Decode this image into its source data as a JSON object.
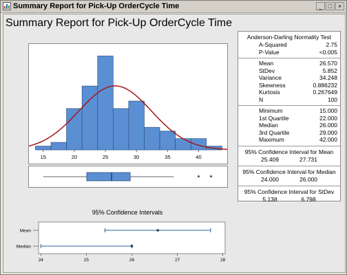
{
  "window": {
    "title": "Summary Report for Pick-Up OrderCycle Time",
    "buttons": {
      "minimize": "_",
      "maximize": "□",
      "close": "×"
    }
  },
  "report_title": "Summary Report for Pick-Up OrderCycle Time",
  "stats": {
    "normality": {
      "title": "Anderson-Darling Normality Test",
      "rows": [
        {
          "label": "A-Squared",
          "value": "2.75"
        },
        {
          "label": "P-Value",
          "value": "<0.005"
        }
      ]
    },
    "moments": [
      {
        "label": "Mean",
        "value": "26.570"
      },
      {
        "label": "StDev",
        "value": "5.852"
      },
      {
        "label": "Variance",
        "value": "34.248"
      },
      {
        "label": "Skewness",
        "value": "0.886232"
      },
      {
        "label": "Kurtosis",
        "value": "0.267649"
      },
      {
        "label": "N",
        "value": "100"
      }
    ],
    "quartiles": [
      {
        "label": "Minimum",
        "value": "15.000"
      },
      {
        "label": "1st Quartile",
        "value": "22.000"
      },
      {
        "label": "Median",
        "value": "26.000"
      },
      {
        "label": "3rd Quartile",
        "value": "29.000"
      },
      {
        "label": "Maximum",
        "value": "42.000"
      }
    ],
    "ci_mean": {
      "title": "95% Confidence Interval for Mean",
      "low": "25.409",
      "high": "27.731"
    },
    "ci_median": {
      "title": "95% Confidence Interval for Median",
      "low": "24.000",
      "high": "26.000"
    },
    "ci_stdev": {
      "title": "95% Confidence Interval for StDev",
      "low": "5.138",
      "high": "6.798"
    }
  },
  "histogram": {
    "bins": [
      {
        "x0": 13.75,
        "x1": 16.25,
        "count": 1
      },
      {
        "x0": 16.25,
        "x1": 18.75,
        "count": 2
      },
      {
        "x0": 18.75,
        "x1": 21.25,
        "count": 11
      },
      {
        "x0": 21.25,
        "x1": 23.75,
        "count": 17
      },
      {
        "x0": 23.75,
        "x1": 26.25,
        "count": 25
      },
      {
        "x0": 26.25,
        "x1": 28.75,
        "count": 11
      },
      {
        "x0": 28.75,
        "x1": 31.25,
        "count": 13
      },
      {
        "x0": 31.25,
        "x1": 33.75,
        "count": 6
      },
      {
        "x0": 33.75,
        "x1": 36.25,
        "count": 5
      },
      {
        "x0": 36.25,
        "x1": 38.75,
        "count": 3
      },
      {
        "x0": 38.75,
        "x1": 41.25,
        "count": 3
      },
      {
        "x0": 41.25,
        "x1": 43.75,
        "count": 1
      }
    ],
    "xlim": [
      12.7,
      44.6
    ],
    "ymax": 26,
    "xticks": [
      "15",
      "20",
      "25",
      "30",
      "35",
      "40"
    ],
    "normal_curve": {
      "mean": 26.57,
      "stdev": 5.852,
      "n": 100,
      "binwidth": 2.5
    },
    "bar_color": "#5b8fd4",
    "curve_color": "#a01818"
  },
  "boxplot": {
    "whisker_low": 15,
    "q1": 22,
    "median": 26,
    "q3": 29,
    "whisker_high": 36,
    "outliers": [
      40,
      42
    ],
    "outlier_symbol": "*",
    "box_color": "#5b8fd4"
  },
  "ci_plot": {
    "title": "95% Confidence Intervals",
    "rows": [
      {
        "label": "Mean",
        "low": 25.409,
        "high": 27.731,
        "point": 26.57
      },
      {
        "label": "Median",
        "low": 24.0,
        "high": 26.0,
        "point": 26.0
      }
    ],
    "xlim": [
      23.95,
      28.05
    ],
    "xticks": [
      "24",
      "25",
      "26",
      "27",
      "28"
    ],
    "line_color": "#2b5d9c"
  }
}
